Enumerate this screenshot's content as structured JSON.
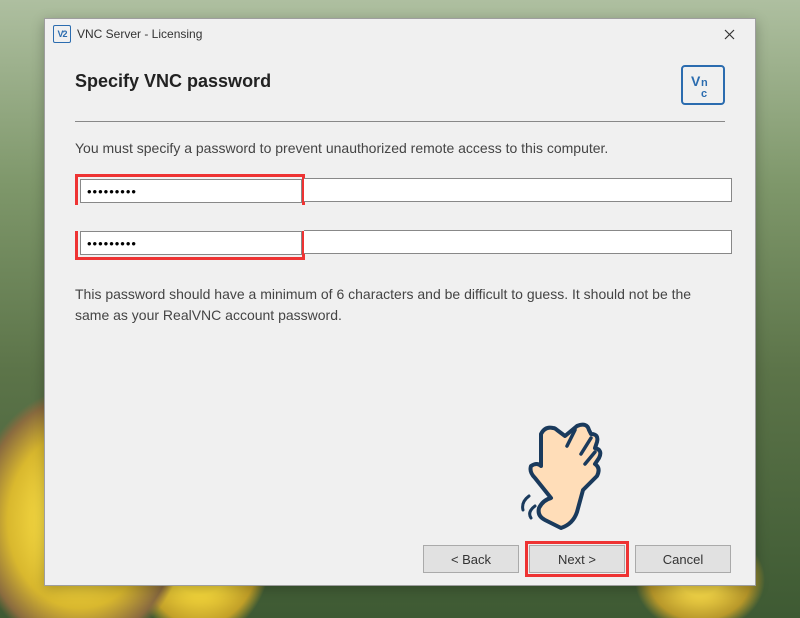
{
  "titlebar": {
    "icon_text": "V2",
    "title": "VNC Server - Licensing"
  },
  "header": {
    "title": "Specify VNC password",
    "logo_text": "V2"
  },
  "instruction": "You must specify a password to prevent unauthorized remote access to this computer.",
  "password": {
    "value1": "•••••••••",
    "value2": "•••••••••"
  },
  "hint": "This password should have a minimum of 6 characters and be difficult to guess. It should not be the same as your RealVNC account password.",
  "buttons": {
    "back": "< Back",
    "next": "Next >",
    "cancel": "Cancel"
  }
}
